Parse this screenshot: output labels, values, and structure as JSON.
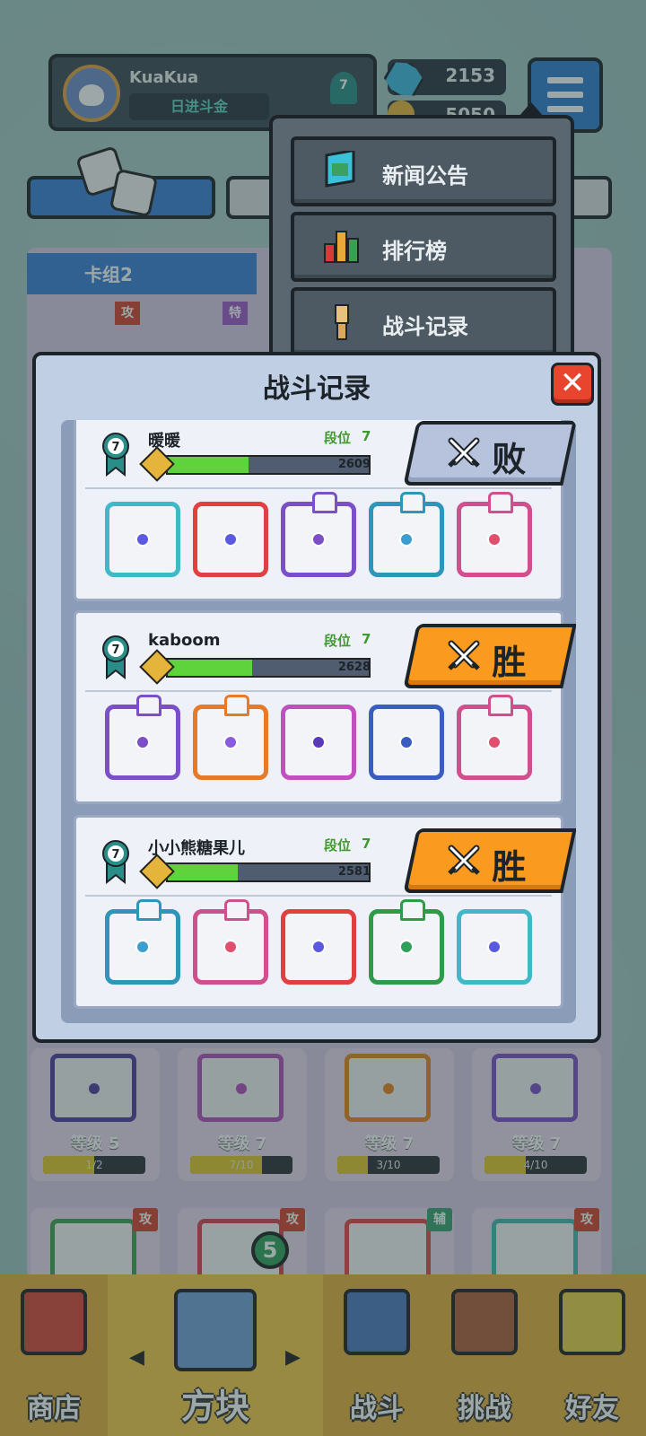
{
  "header": {
    "player_name": "KuaKua",
    "player_title": "日进斗金",
    "player_level": "7",
    "gems": "2153",
    "coins": "5050"
  },
  "deck": {
    "label": "卡组2",
    "top_tags": [
      "攻",
      "特"
    ],
    "cards": [
      {
        "level_label": "等级 5",
        "progress": "1/2",
        "fill": 0.5,
        "color": "#4d3c9e"
      },
      {
        "level_label": "等级 7",
        "progress": "7/10",
        "fill": 0.7,
        "color": "#b04fb8"
      },
      {
        "level_label": "等级 7",
        "progress": "3/10",
        "fill": 0.3,
        "color": "#e68420"
      },
      {
        "level_label": "等级 7",
        "progress": "4/10",
        "fill": 0.4,
        "color": "#7a4fc8"
      }
    ],
    "bottom_tags": [
      "攻",
      "攻",
      "辅",
      "攻"
    ]
  },
  "dropdown": {
    "items": [
      {
        "label": "新闻公告",
        "icon": "news-icon"
      },
      {
        "label": "排行榜",
        "icon": "leaderboard-icon"
      },
      {
        "label": "战斗记录",
        "icon": "battle-record-icon"
      }
    ]
  },
  "modal": {
    "title": "战斗记录",
    "close_label": "✕",
    "records": [
      {
        "name": "暖暖",
        "rank_label": "段位",
        "rank": "7",
        "rank_badge": "7",
        "trophies": "2609",
        "progress": 0.4,
        "result": "败",
        "result_type": "lose",
        "dice": [
          {
            "border": "#3fb8c8",
            "pip": "#5a5ae0",
            "legend": false
          },
          {
            "border": "#e04040",
            "pip": "#5a5ae0",
            "legend": false
          },
          {
            "border": "#7a4fc8",
            "pip": "#7a4fc8",
            "legend": true
          },
          {
            "border": "#2e96b8",
            "pip": "#3a9ed0",
            "legend": true
          },
          {
            "border": "#d0508e",
            "pip": "#e0506e",
            "legend": true
          }
        ]
      },
      {
        "name": "kaboom",
        "rank_label": "段位",
        "rank": "7",
        "rank_badge": "7",
        "trophies": "2628",
        "progress": 0.42,
        "result": "胜",
        "result_type": "win",
        "dice": [
          {
            "border": "#7a4fc8",
            "pip": "#7a4fc8",
            "legend": true
          },
          {
            "border": "#e67a28",
            "pip": "#8a5ae0",
            "legend": true
          },
          {
            "border": "#c24fc0",
            "pip": "#5a3ab8",
            "legend": false
          },
          {
            "border": "#3a5ec0",
            "pip": "#3a5ec0",
            "legend": false
          },
          {
            "border": "#d0508e",
            "pip": "#e0506e",
            "legend": true
          }
        ]
      },
      {
        "name": "小小熊糖果儿",
        "rank_label": "段位",
        "rank": "7",
        "rank_badge": "7",
        "trophies": "2581",
        "progress": 0.35,
        "result": "胜",
        "result_type": "win",
        "dice": [
          {
            "border": "#2e96b8",
            "pip": "#3a9ed0",
            "legend": true
          },
          {
            "border": "#d0508e",
            "pip": "#e0506e",
            "legend": true
          },
          {
            "border": "#e04040",
            "pip": "#5a5ae0",
            "legend": false
          },
          {
            "border": "#2e9a4a",
            "pip": "#2ea05a",
            "legend": true
          },
          {
            "border": "#3fb8c8",
            "pip": "#5a5ae0",
            "legend": false
          }
        ]
      }
    ]
  },
  "nav": {
    "items": [
      {
        "label": "商店",
        "icon": "shop-icon"
      },
      {
        "label": "方块",
        "icon": "dice-box-icon"
      },
      {
        "label": "战斗",
        "icon": "battle-icon"
      },
      {
        "label": "挑战",
        "icon": "challenge-icon"
      },
      {
        "label": "好友",
        "icon": "friends-icon"
      }
    ],
    "badge": "5"
  },
  "colors": {
    "win": "#fa9a1e",
    "lose": "#b7c3dc",
    "xp_fill": "#5ed33c",
    "rank_text": "#3f9a2e",
    "close": "#e8442e"
  }
}
